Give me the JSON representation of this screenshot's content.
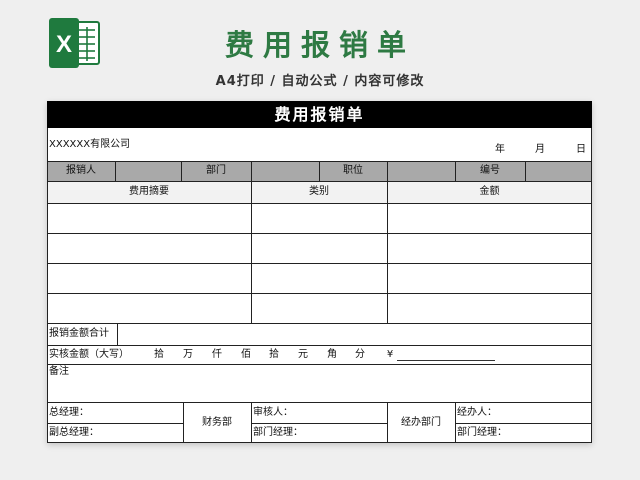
{
  "header": {
    "title": "费用报销单",
    "subtitle": "A4打印 / 自动公式 / 内容可修改"
  },
  "logo": {
    "icon": "excel-logo-icon",
    "letter": "X",
    "color": "#1f7a3e"
  },
  "form": {
    "title": "费用报销单",
    "company": "XXXXXX有限公司",
    "date_labels": {
      "year": "年",
      "month": "月",
      "day": "日"
    },
    "info_row": {
      "reporter_label": "报销人",
      "department_label": "部门",
      "position_label": "职位",
      "number_label": "编号"
    },
    "columns": [
      "费用摘要",
      "类别",
      "金额"
    ],
    "rows": [
      [
        "",
        "",
        ""
      ],
      [
        "",
        "",
        ""
      ],
      [
        "",
        "",
        ""
      ],
      [
        "",
        "",
        ""
      ]
    ],
    "total_label": "报销金额合计",
    "amount_label": "实核金额（大写）",
    "amount_units": [
      "拾",
      "万",
      "仟",
      "佰",
      "拾",
      "元",
      "角",
      "分"
    ],
    "amount_currency": "¥",
    "remark_label": "备注",
    "signatures": {
      "gm_label": "总经理：",
      "vice_gm_label": "副总经理：",
      "finance_label": "财务部",
      "reviewer_label": "审核人：",
      "dept_manager_label": "部门经理：",
      "handling_dept_label": "经办部门",
      "handler_label": "经办人：",
      "dept_manager2_label": "部门经理："
    }
  }
}
